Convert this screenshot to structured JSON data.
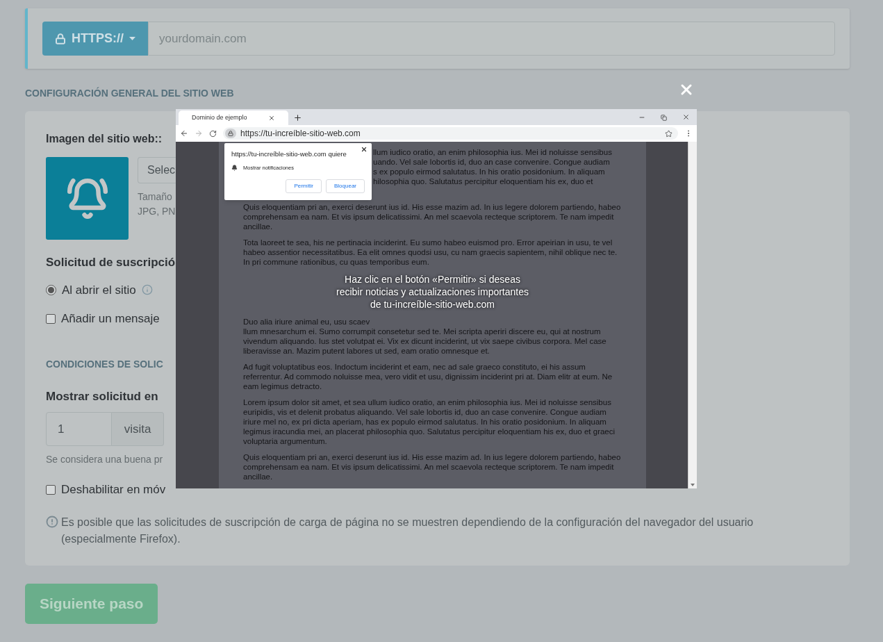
{
  "url_bar": {
    "protocol": "HTTPS://",
    "placeholder": "yourdomain.com"
  },
  "section_title": "CONFIGURACIÓN GENERAL DEL SITIO WEB",
  "settings": {
    "image_label": "Imagen del sitio web::",
    "select_button": "Selec",
    "size_hint_lines": [
      "Tamaño",
      "JPG, PN"
    ],
    "request_label": "Solicitud de suscripció",
    "options": [
      {
        "kind": "radio",
        "label": "Al abrir el sitio",
        "selected": true
      },
      {
        "kind": "checkbox",
        "label": "Añadir un mensaje",
        "checked": false
      }
    ],
    "conditions_title": "CONDICIONES DE SOLIC",
    "show_label": "Mostrar solicitud en",
    "visits": {
      "value": "1",
      "unit": "visita"
    },
    "hint": "Se considera una buena pr",
    "mobile": {
      "label": "Deshabilitar en móv",
      "checked": false
    },
    "warning": "Es posible que las solicitudes de suscripción de carga de página no se muestren dependiendo de la configuración del navegador del usuario (especialmente Firefox)."
  },
  "next_button": "Siguiente paso",
  "preview": {
    "tab_title": "Dominio de ejemplo",
    "url": "https://tu-increíble-sitio-web.com",
    "popup": {
      "message": "https://tu-increíble-sitio-web.com quiere",
      "permission": "Mostrar notificaciones",
      "buttons": [
        "Permitir",
        "Bloquear"
      ]
    },
    "first_paragraph_lines": [
      "llum iudico oratio, an enim philosophia ius. Mei id noluisse sensibus",
      "uando. Vel sale lobortis id, duo an case convenire. Congue audiam",
      "s ex populo eirmod salutatus. In his oratio posidonium. In aliquam",
      "hilosophia quo. Salutatus percipitur eloquentiam his ex, duo et"
    ],
    "paragraphs": [
      [
        "Quis eloquentiam pri an, exerci deserunt ius id. His esse mazim ad. In ius legere dolorem partiendo, habeo comprehensam ea nam. Et vis ipsum delicatissimi. An mel scaevola recteque scriptorem. Te nam impedit ancillae."
      ],
      [
        "Tota laoreet te sea, his ne pertinacia inciderint. Eu sumo habeo euismod pro. Error apeirian in usu, te vel habeo assentior necessitatibus. Ea elit omnes quodsi usu, cu nam graecis sapientem, nihil oblique nec te. In pri commune rationibus, cu quas temporibus eum."
      ],
      [
        "Duo alia iriure animal eu, usu scaev",
        "llum mnesarchum ei. Sumo corrumpit consetetur sed te. Mei scripta aperiri discere eu, qui at nostrum vivendum aliquando. Ius stet volutpat ei. Vix ex dicunt inciderint, ut vix saepe civibus corpora. Mel case liberavisse an. Mazim putent labores ut sed, eam oratio omnesque et."
      ],
      [
        "Ad fugit voluptatibus eos. Indoctum inciderint et eam, nec ad sale graeco constituto, ei his assum referrentur. Ad commodo noluisse mea, vero vidit et usu, dignissim inciderint pri at. Diam elitr at eum. Ne eam legimus detracto."
      ],
      [
        "Lorem ipsum dolor sit amet, et sea ullum iudico oratio, an enim philosophia ius. Mei id noluisse sensibus euripidis, vis et delenit probatus aliquando. Vel sale lobortis id, duo an case convenire. Congue audiam iriure mel no, ex pri dicta aperiam, has ex populo eirmod salutatus. In his oratio posidonium. In aliquam legimus iracundia mei, an placerat philosophia quo. Salutatus percipitur eloquentiam his ex, duo et graeci voluptaria argumentum."
      ],
      [
        "Quis eloquentiam pri an, exerci deserunt ius id. His esse mazim ad. In ius legere dolorem partiendo, habeo comprehensam ea nam. Et vis ipsum delicatissimi. An mel scaevola recteque scriptorem. Te nam impedit ancillae."
      ]
    ],
    "caption_lines": [
      "Haz clic en el botón «Permitir» si deseas",
      "recibir noticias y actualizaciones importantes",
      "de tu-increíble-sitio-web.com"
    ]
  }
}
